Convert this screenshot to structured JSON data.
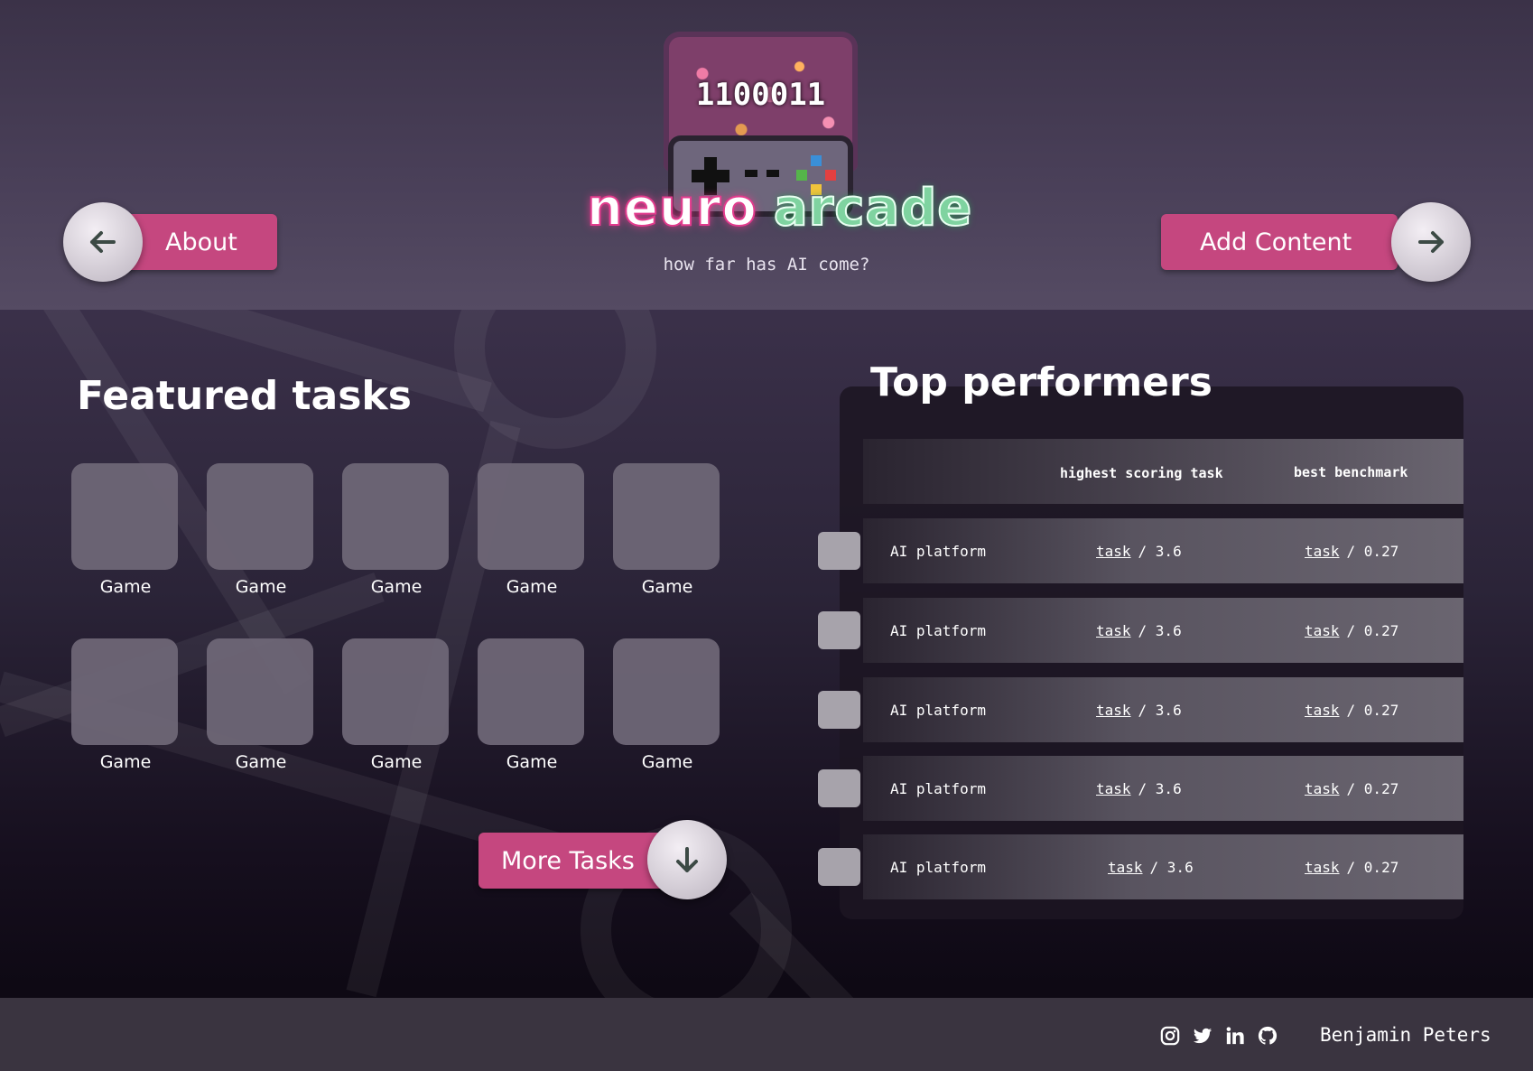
{
  "header": {
    "logo_bits": "1100011",
    "logo_word_1": "neuro",
    "logo_word_2": "arcade",
    "tagline": "how far has AI come?"
  },
  "nav": {
    "about_label": "About",
    "add_content_label": "Add Content"
  },
  "featured": {
    "title": "Featured tasks",
    "games": [
      {
        "label": "Game"
      },
      {
        "label": "Game"
      },
      {
        "label": "Game"
      },
      {
        "label": "Game"
      },
      {
        "label": "Game"
      },
      {
        "label": "Game"
      },
      {
        "label": "Game"
      },
      {
        "label": "Game"
      },
      {
        "label": "Game"
      },
      {
        "label": "Game"
      }
    ],
    "more_label": "More Tasks"
  },
  "performers": {
    "title": "Top performers",
    "col_task": "highest scoring task",
    "col_bench": "best benchmark",
    "rows": [
      {
        "name": "AI platform",
        "task_link": "task",
        "task_score": "/ 3.6",
        "bench_link": "task",
        "bench_score": "/ 0.27"
      },
      {
        "name": "AI platform",
        "task_link": "task",
        "task_score": "/ 3.6",
        "bench_link": "task",
        "bench_score": "/ 0.27"
      },
      {
        "name": "AI platform",
        "task_link": "task",
        "task_score": "/ 3.6",
        "bench_link": "task",
        "bench_score": "/ 0.27"
      },
      {
        "name": "AI platform",
        "task_link": "task",
        "task_score": "/ 3.6",
        "bench_link": "task",
        "bench_score": "/ 0.27"
      },
      {
        "name": "AI platform",
        "task_link": "task",
        "task_score": "/ 3.6",
        "bench_link": "task",
        "bench_score": "/ 0.27"
      }
    ]
  },
  "footer": {
    "icons": [
      "instagram-icon",
      "twitter-icon",
      "linkedin-icon",
      "github-icon"
    ],
    "credit": "Benjamin Peters"
  },
  "colors": {
    "accent_pink": "#c5477f",
    "logo_green": "#7fd3a0",
    "tile_gray": "#6e6676"
  }
}
